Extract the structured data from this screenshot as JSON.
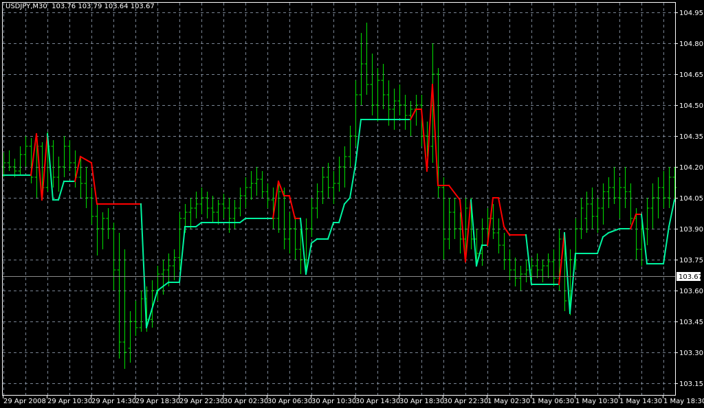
{
  "header": {
    "symbol": "USDJPY,M30",
    "open": "103.76",
    "high": "103.79",
    "low": "103.64",
    "close": "103.67"
  },
  "colors": {
    "background": "#000000",
    "grid": "#7a8594",
    "bars": "#00e000",
    "line_up": "#00f5a0",
    "line_down": "#ff0000",
    "axis": "#ffffff",
    "current_price_line": "#8a8a8a"
  },
  "chart_data": {
    "type": "line",
    "chart_kind": "OHLC bars with colored moving-average line",
    "timeframe": "M30",
    "grid": true,
    "ylim": [
      103.1,
      105.0
    ],
    "y_ticks": [
      "104.95",
      "104.80",
      "104.65",
      "104.50",
      "104.35",
      "104.20",
      "104.05",
      "103.90",
      "103.75",
      "103.60",
      "103.45",
      "103.30",
      "103.15"
    ],
    "x_ticks": [
      "29 Apr 2008",
      "29 Apr 10:30",
      "29 Apr 14:30",
      "29 Apr 18:30",
      "29 Apr 22:30",
      "30 Apr 02:30",
      "30 Apr 06:30",
      "30 Apr 10:30",
      "30 Apr 14:30",
      "30 Apr 18:30",
      "30 Apr 22:30",
      "1 May 02:30",
      "1 May 06:30",
      "1 May 10:30",
      "1 May 14:30",
      "1 May 18:30"
    ],
    "current_price": "103.67",
    "bars_ohlc": [
      [
        104.2,
        104.27,
        104.15,
        104.22
      ],
      [
        104.22,
        104.28,
        104.18,
        104.2
      ],
      [
        104.2,
        104.24,
        104.15,
        104.18
      ],
      [
        104.18,
        104.3,
        104.16,
        104.26
      ],
      [
        104.26,
        104.35,
        104.2,
        104.3
      ],
      [
        104.3,
        104.34,
        104.12,
        104.15
      ],
      [
        104.15,
        104.36,
        104.05,
        104.3
      ],
      [
        104.3,
        104.32,
        104.04,
        104.1
      ],
      [
        104.1,
        104.37,
        104.08,
        104.3
      ],
      [
        104.3,
        104.33,
        104.1,
        104.15
      ],
      [
        104.15,
        104.25,
        104.08,
        104.2
      ],
      [
        104.2,
        104.35,
        104.15,
        104.3
      ],
      [
        104.3,
        104.33,
        104.18,
        104.22
      ],
      [
        104.22,
        104.28,
        104.1,
        104.15
      ],
      [
        104.15,
        104.25,
        104.05,
        104.12
      ],
      [
        104.12,
        104.2,
        104.0,
        104.05
      ],
      [
        104.05,
        104.1,
        103.92,
        103.96
      ],
      [
        103.96,
        104.02,
        103.77,
        103.9
      ],
      [
        103.9,
        103.98,
        103.8,
        103.95
      ],
      [
        103.95,
        104.0,
        103.85,
        103.9
      ],
      [
        103.9,
        103.93,
        103.6,
        103.7
      ],
      [
        103.7,
        103.88,
        103.27,
        103.35
      ],
      [
        103.35,
        103.8,
        103.22,
        103.3
      ],
      [
        103.32,
        103.5,
        103.25,
        103.45
      ],
      [
        103.45,
        103.55,
        103.38,
        103.42
      ],
      [
        103.42,
        103.6,
        103.4,
        103.56
      ],
      [
        103.56,
        103.62,
        103.4,
        103.46
      ],
      [
        103.46,
        103.65,
        103.42,
        103.6
      ],
      [
        103.6,
        103.72,
        103.55,
        103.68
      ],
      [
        103.68,
        103.75,
        103.58,
        103.7
      ],
      [
        103.7,
        103.78,
        103.62,
        103.72
      ],
      [
        103.72,
        103.8,
        103.65,
        103.76
      ],
      [
        103.76,
        103.98,
        103.7,
        103.95
      ],
      [
        103.95,
        104.02,
        103.88,
        103.98
      ],
      [
        103.98,
        104.05,
        103.9,
        104.0
      ],
      [
        104.0,
        104.08,
        103.95,
        104.02
      ],
      [
        104.02,
        104.1,
        103.97,
        104.05
      ],
      [
        104.05,
        104.08,
        103.95,
        104.0
      ],
      [
        104.0,
        104.06,
        103.93,
        103.98
      ],
      [
        103.98,
        104.04,
        103.92,
        104.02
      ],
      [
        104.02,
        104.07,
        103.95,
        104.0
      ],
      [
        104.0,
        104.05,
        103.88,
        103.95
      ],
      [
        103.95,
        104.04,
        103.9,
        104.0
      ],
      [
        104.0,
        104.1,
        103.96,
        104.06
      ],
      [
        104.06,
        104.15,
        104.0,
        104.1
      ],
      [
        104.1,
        104.18,
        104.04,
        104.12
      ],
      [
        104.12,
        104.2,
        104.06,
        104.14
      ],
      [
        104.14,
        104.18,
        104.05,
        104.08
      ],
      [
        104.08,
        104.12,
        104.0,
        104.04
      ],
      [
        104.04,
        104.1,
        103.9,
        103.95
      ],
      [
        103.95,
        104.12,
        103.88,
        104.08
      ],
      [
        104.08,
        104.1,
        103.8,
        103.85
      ],
      [
        103.85,
        103.98,
        103.78,
        103.9
      ],
      [
        103.9,
        103.96,
        103.75,
        103.8
      ],
      [
        103.8,
        103.9,
        103.68,
        103.75
      ],
      [
        103.75,
        103.95,
        103.7,
        103.9
      ],
      [
        103.9,
        104.05,
        103.86,
        104.0
      ],
      [
        104.0,
        104.12,
        103.95,
        104.08
      ],
      [
        104.08,
        104.2,
        104.02,
        104.15
      ],
      [
        104.15,
        104.22,
        104.05,
        104.1
      ],
      [
        104.1,
        104.18,
        104.02,
        104.12
      ],
      [
        104.12,
        104.25,
        104.08,
        104.2
      ],
      [
        104.2,
        104.3,
        104.1,
        104.25
      ],
      [
        104.25,
        104.4,
        104.2,
        104.35
      ],
      [
        104.35,
        104.62,
        104.3,
        104.55
      ],
      [
        104.55,
        104.85,
        104.5,
        104.7
      ],
      [
        104.7,
        104.9,
        104.55,
        104.6
      ],
      [
        104.6,
        104.75,
        104.45,
        104.5
      ],
      [
        104.5,
        104.68,
        104.42,
        104.62
      ],
      [
        104.62,
        104.7,
        104.48,
        104.55
      ],
      [
        104.55,
        104.62,
        104.4,
        104.48
      ],
      [
        104.48,
        104.58,
        104.38,
        104.52
      ],
      [
        104.52,
        104.6,
        104.45,
        104.5
      ],
      [
        104.5,
        104.55,
        104.38,
        104.45
      ],
      [
        104.45,
        104.52,
        104.35,
        104.48
      ],
      [
        104.48,
        104.55,
        104.4,
        104.5
      ],
      [
        104.5,
        104.55,
        104.3,
        104.35
      ],
      [
        104.35,
        104.42,
        104.25,
        104.3
      ],
      [
        104.3,
        104.8,
        104.22,
        104.65
      ],
      [
        104.65,
        104.68,
        104.05,
        104.1
      ],
      [
        104.1,
        104.15,
        103.75,
        103.85
      ],
      [
        103.85,
        104.05,
        103.8,
        103.98
      ],
      [
        103.98,
        104.05,
        103.85,
        103.9
      ],
      [
        103.9,
        103.98,
        103.78,
        103.85
      ],
      [
        103.85,
        104.05,
        103.75,
        104.0
      ],
      [
        104.0,
        104.05,
        103.8,
        103.85
      ],
      [
        103.85,
        103.9,
        103.72,
        103.78
      ],
      [
        103.78,
        103.95,
        103.72,
        103.9
      ],
      [
        103.9,
        104.0,
        103.82,
        103.95
      ],
      [
        103.95,
        104.02,
        103.85,
        103.88
      ],
      [
        103.88,
        103.95,
        103.78,
        103.82
      ],
      [
        103.82,
        103.88,
        103.7,
        103.75
      ],
      [
        103.75,
        103.8,
        103.65,
        103.7
      ],
      [
        103.7,
        103.76,
        103.62,
        103.66
      ],
      [
        103.66,
        103.72,
        103.6,
        103.68
      ],
      [
        103.68,
        103.75,
        103.64,
        103.7
      ],
      [
        103.7,
        103.76,
        103.65,
        103.72
      ],
      [
        103.72,
        103.78,
        103.66,
        103.7
      ],
      [
        103.7,
        103.75,
        103.64,
        103.72
      ],
      [
        103.72,
        103.78,
        103.66,
        103.74
      ],
      [
        103.74,
        103.8,
        103.62,
        103.66
      ],
      [
        103.66,
        103.9,
        103.6,
        103.85
      ],
      [
        103.85,
        103.88,
        103.5,
        103.55
      ],
      [
        103.55,
        103.8,
        103.48,
        103.75
      ],
      [
        103.75,
        103.95,
        103.7,
        103.9
      ],
      [
        103.9,
        104.05,
        103.85,
        104.0
      ],
      [
        103.95,
        104.08,
        103.88,
        104.02
      ],
      [
        104.02,
        104.1,
        103.9,
        103.96
      ],
      [
        103.96,
        104.05,
        103.88,
        104.0
      ],
      [
        104.0,
        104.12,
        103.92,
        104.08
      ],
      [
        104.08,
        104.15,
        104.0,
        104.1
      ],
      [
        104.1,
        104.2,
        104.02,
        104.05
      ],
      [
        104.05,
        104.15,
        103.95,
        104.1
      ],
      [
        104.1,
        104.2,
        104.0,
        104.08
      ],
      [
        104.08,
        104.12,
        103.92,
        103.95
      ],
      [
        103.95,
        104.0,
        103.75,
        103.8
      ],
      [
        103.8,
        103.95,
        103.72,
        103.9
      ],
      [
        103.9,
        104.05,
        103.82,
        104.0
      ],
      [
        104.0,
        104.12,
        103.9,
        104.05
      ],
      [
        104.05,
        104.15,
        103.95,
        104.1
      ],
      [
        104.1,
        104.18,
        104.0,
        104.05
      ],
      [
        104.05,
        104.2,
        104.0,
        104.15
      ],
      [
        104.15,
        104.2,
        104.03,
        104.1
      ]
    ],
    "line_points": [
      [
        0,
        104.16,
        "up"
      ],
      [
        5,
        104.16,
        "up"
      ],
      [
        6,
        104.36,
        "down"
      ],
      [
        7,
        104.04,
        "down"
      ],
      [
        8,
        104.36,
        "down"
      ],
      [
        9,
        104.04,
        "up"
      ],
      [
        10,
        104.04,
        "up"
      ],
      [
        11,
        104.13,
        "up"
      ],
      [
        13,
        104.13,
        "up"
      ],
      [
        14,
        104.25,
        "down"
      ],
      [
        16,
        104.22,
        "down"
      ],
      [
        17,
        104.02,
        "down"
      ],
      [
        25,
        104.02,
        "down"
      ],
      [
        26,
        103.42,
        "up"
      ],
      [
        27,
        103.51,
        "up"
      ],
      [
        28,
        103.6,
        "up"
      ],
      [
        30,
        103.64,
        "up"
      ],
      [
        32,
        103.64,
        "up"
      ],
      [
        33,
        103.91,
        "up"
      ],
      [
        35,
        103.91,
        "up"
      ],
      [
        36,
        103.93,
        "up"
      ],
      [
        43,
        103.93,
        "up"
      ],
      [
        44,
        103.95,
        "up"
      ],
      [
        49,
        103.95,
        "up"
      ],
      [
        50,
        104.13,
        "down"
      ],
      [
        51,
        104.06,
        "down"
      ],
      [
        52,
        104.06,
        "down"
      ],
      [
        53,
        103.95,
        "down"
      ],
      [
        54,
        103.95,
        "down"
      ],
      [
        55,
        103.68,
        "up"
      ],
      [
        56,
        103.83,
        "up"
      ],
      [
        57,
        103.85,
        "up"
      ],
      [
        59,
        103.85,
        "up"
      ],
      [
        60,
        103.93,
        "up"
      ],
      [
        61,
        103.93,
        "up"
      ],
      [
        62,
        104.02,
        "up"
      ],
      [
        63,
        104.05,
        "up"
      ],
      [
        64,
        104.21,
        "up"
      ],
      [
        65,
        104.43,
        "up"
      ],
      [
        74,
        104.43,
        "up"
      ],
      [
        75,
        104.48,
        "down"
      ],
      [
        76,
        104.48,
        "down"
      ],
      [
        77,
        104.18,
        "down"
      ],
      [
        78,
        104.6,
        "down"
      ],
      [
        79,
        104.11,
        "down"
      ],
      [
        81,
        104.11,
        "down"
      ],
      [
        83,
        104.04,
        "down"
      ],
      [
        84,
        103.74,
        "down"
      ],
      [
        85,
        104.04,
        "down"
      ],
      [
        86,
        103.72,
        "up"
      ],
      [
        87,
        103.82,
        "up"
      ],
      [
        88,
        103.82,
        "up"
      ],
      [
        89,
        104.05,
        "down"
      ],
      [
        90,
        104.05,
        "down"
      ],
      [
        91,
        103.91,
        "down"
      ],
      [
        92,
        103.87,
        "down"
      ],
      [
        95,
        103.87,
        "down"
      ],
      [
        96,
        103.63,
        "up"
      ],
      [
        101,
        103.63,
        "up"
      ],
      [
        102,
        103.88,
        "down"
      ],
      [
        103,
        103.49,
        "up"
      ],
      [
        104,
        103.78,
        "up"
      ],
      [
        108,
        103.78,
        "up"
      ],
      [
        109,
        103.86,
        "up"
      ],
      [
        110,
        103.88,
        "up"
      ],
      [
        112,
        103.9,
        "up"
      ],
      [
        114,
        103.9,
        "up"
      ],
      [
        115,
        103.97,
        "down"
      ],
      [
        116,
        103.97,
        "down"
      ],
      [
        117,
        103.73,
        "up"
      ],
      [
        120,
        103.73,
        "up"
      ],
      [
        121,
        103.91,
        "up"
      ],
      [
        122,
        104.04,
        "up"
      ]
    ]
  }
}
